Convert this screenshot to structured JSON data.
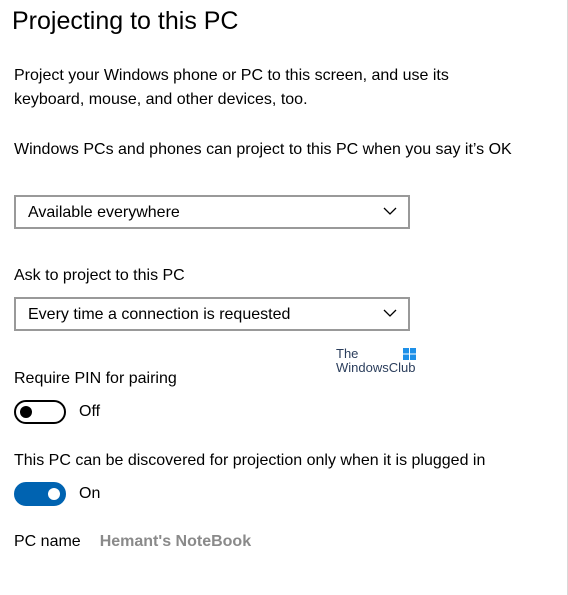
{
  "page": {
    "title": "Projecting to this PC",
    "description": "Project your Windows phone or PC to this screen, and use its keyboard, mouse, and other devices, too."
  },
  "availability": {
    "label": "Windows PCs and phones can project to this PC when you say it’s OK",
    "selected": "Available everywhere"
  },
  "ask": {
    "label": "Ask to project to this PC",
    "selected": "Every time a connection is requested"
  },
  "pin": {
    "label": "Require PIN for pairing",
    "state_label": "Off",
    "is_on": false
  },
  "plugged_in": {
    "label": "This PC can be discovered for projection only when it is plugged in",
    "state_label": "On",
    "is_on": true
  },
  "pc_name": {
    "label": "PC name",
    "value": "Hemant's NoteBook"
  },
  "watermark": {
    "line1": "The",
    "line2": "WindowsClub"
  },
  "colors": {
    "accent": "#0063b1",
    "dropdown_border": "#999999",
    "muted_text": "#8a8a8a"
  },
  "icons": {
    "dropdown_chevron": "chevron-down-icon",
    "watermark_logo": "windows-logo-icon"
  }
}
